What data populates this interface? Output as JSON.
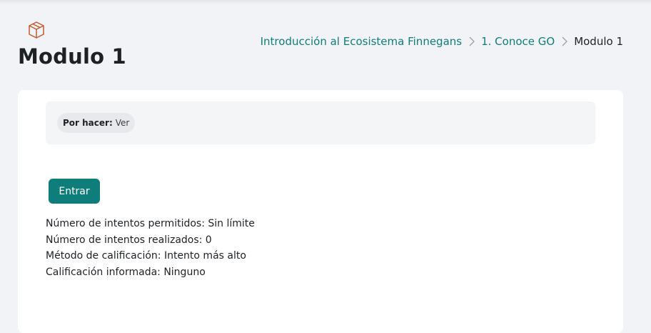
{
  "header": {
    "title": "Modulo 1",
    "icon": "package-icon",
    "icon_color": "#c55a2b"
  },
  "breadcrumb": {
    "items": [
      {
        "label": "Introducción al Ecosistema Finnegans"
      },
      {
        "label": "1. Conoce GO"
      },
      {
        "label": "Modulo 1"
      }
    ]
  },
  "status": {
    "key": "Por hacer:",
    "value": "Ver"
  },
  "actions": {
    "enter_label": "Entrar"
  },
  "details": [
    {
      "text": "Número de intentos permitidos: Sin límite"
    },
    {
      "text": "Número de intentos realizados: 0"
    },
    {
      "text": "Método de calificación: Intento más alto"
    },
    {
      "text": "Calificación informada: Ninguno"
    }
  ],
  "colors": {
    "accent": "#0f7d7a",
    "background": "#f2f3f6"
  }
}
